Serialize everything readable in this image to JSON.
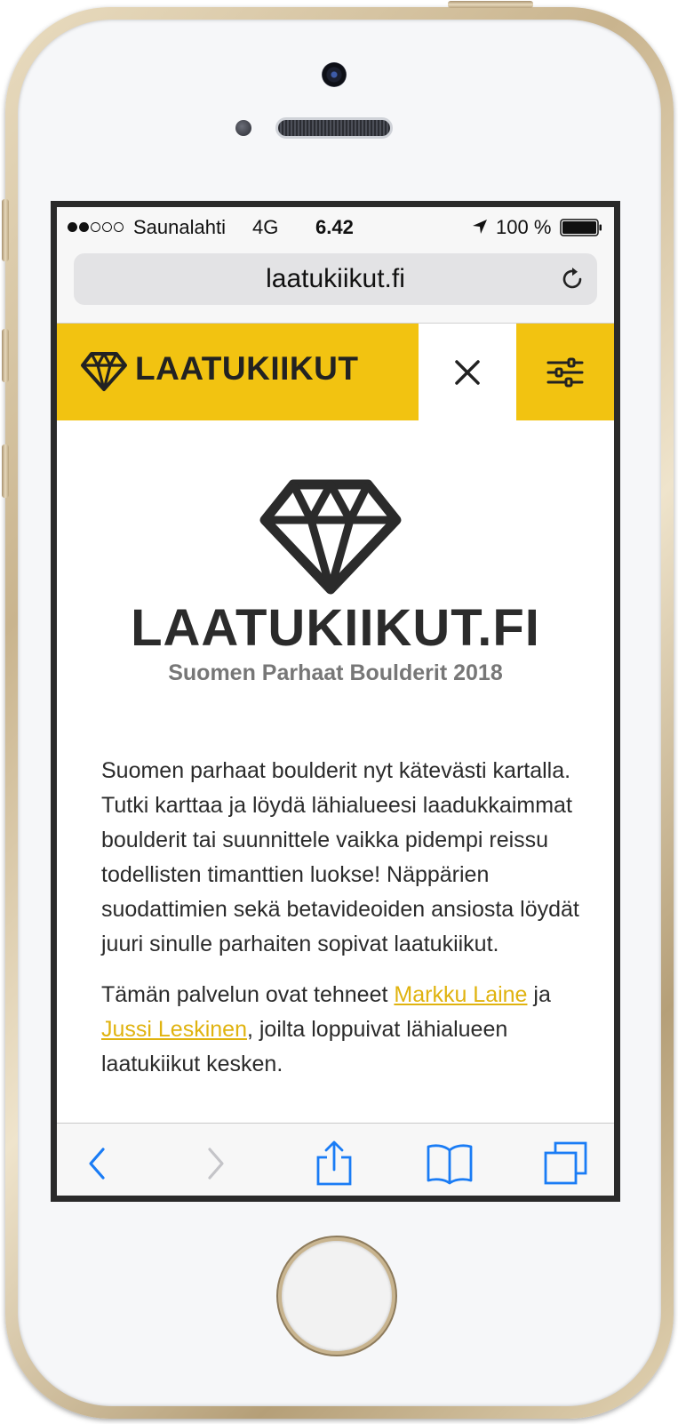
{
  "status_bar": {
    "carrier": "Saunalahti",
    "network": "4G",
    "time": "6.42",
    "battery": "100 %",
    "signal_bars_filled": 2,
    "signal_bars_total": 5
  },
  "browser": {
    "url": "laatukiikut.fi"
  },
  "site_header": {
    "brand_name": "LAATUKIIKUT"
  },
  "hero": {
    "title": "LAATUKIIKUT.FI",
    "subtitle": "Suomen Parhaat Boulderit 2018"
  },
  "content": {
    "paragraph1": "Suomen parhaat boulderit nyt kätevästi kartalla. Tutki karttaa ja löydä lähialueesi laadukkaimmat boulderit tai suunnittele vaikka pidempi reissu todellisten timanttien luokse! Näppärien suodattimien sekä betavideoiden ansiosta löydät juuri sinulle parhaiten sopivat laatukiikut.",
    "paragraph2_before": "Tämän palvelun ovat tehneet ",
    "link1": "Markku Laine",
    "paragraph2_middle": " ja ",
    "link2": "Jussi Leskinen",
    "paragraph2_after": ", joilta loppuivat lähialueen laatukiikut kesken."
  },
  "colors": {
    "brand_yellow": "#f2c311",
    "link_yellow": "#e0b30f",
    "ios_blue": "#1a7cf5",
    "text_dark": "#2b2b2b"
  },
  "icons": {
    "brand": "diamond-icon",
    "close": "close-icon",
    "filter": "sliders-icon",
    "back": "chevron-left-icon",
    "forward": "chevron-right-icon",
    "share": "share-icon",
    "bookmarks": "book-icon",
    "tabs": "tabs-icon",
    "reload": "reload-icon",
    "location": "location-arrow-icon"
  }
}
